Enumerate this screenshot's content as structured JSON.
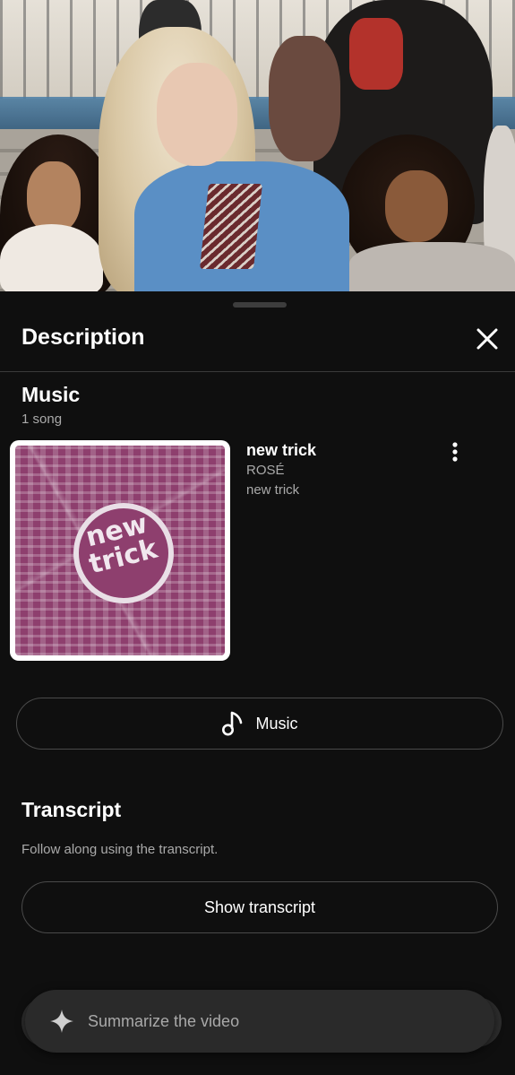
{
  "description": {
    "title": "Description"
  },
  "music": {
    "heading": "Music",
    "count": "1 song",
    "song": {
      "title": "new trick",
      "artist": "ROSÉ",
      "album": "new trick",
      "cover_text": "new trick"
    },
    "button_label": "Music"
  },
  "transcript": {
    "heading": "Transcript",
    "subtitle": "Follow along using the transcript.",
    "button_label": "Show transcript"
  },
  "summarize": {
    "label": "Summarize the video"
  },
  "icons": {
    "close": "close-icon",
    "more": "more-vert-icon",
    "music_note": "music-note-icon",
    "sparkle": "sparkle-icon"
  },
  "colors": {
    "background": "#0f0f0f",
    "cover": "#8e3f6e",
    "muted_text": "#aaaaaa"
  }
}
